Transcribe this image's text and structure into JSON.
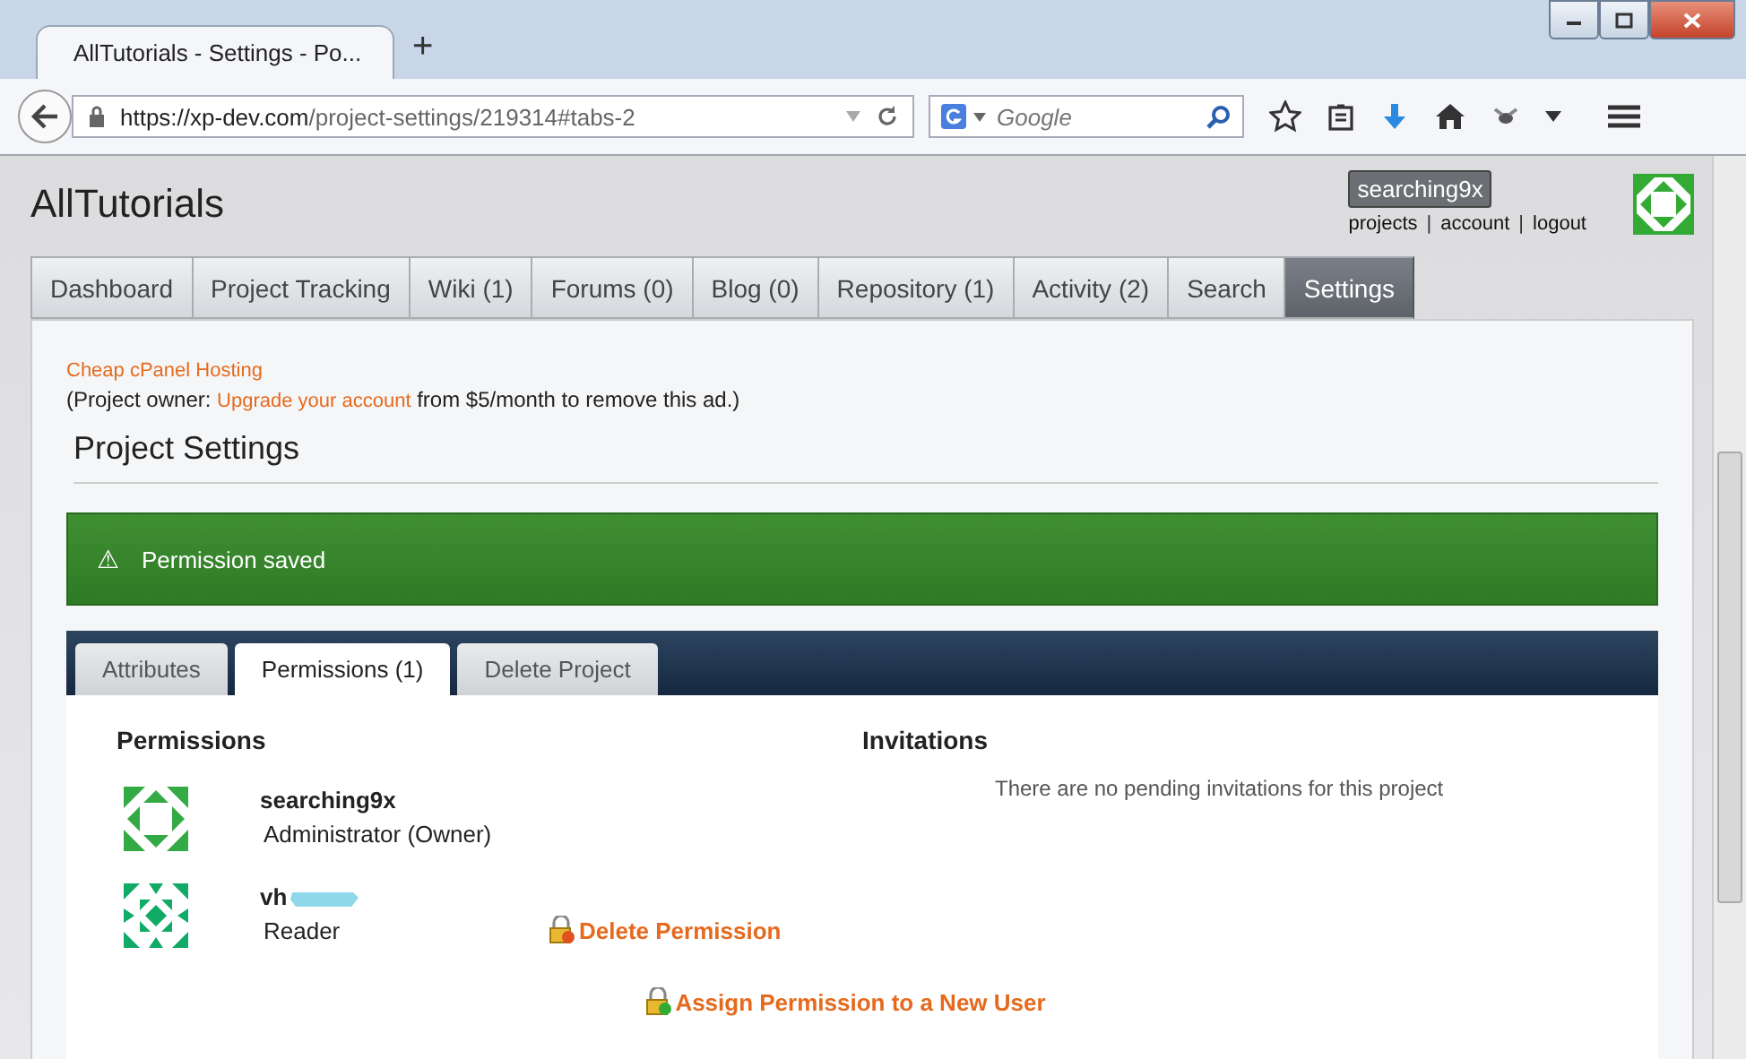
{
  "browser": {
    "tab_title": "AllTutorials - Settings - Po...",
    "new_tab": "+",
    "url_host": "https://xp-dev.com",
    "url_path": "/project-settings/219314#tabs-2",
    "search_placeholder": "Google"
  },
  "site": {
    "title": "AllTutorials",
    "user": "searching9x",
    "user_links": [
      "projects",
      "account",
      "logout"
    ],
    "separator": "|"
  },
  "nav_tabs": [
    {
      "label": "Dashboard",
      "selected": false
    },
    {
      "label": "Project Tracking",
      "selected": false
    },
    {
      "label": "Wiki (1)",
      "selected": false
    },
    {
      "label": "Forums (0)",
      "selected": false
    },
    {
      "label": "Blog (0)",
      "selected": false
    },
    {
      "label": "Repository (1)",
      "selected": false
    },
    {
      "label": "Activity (2)",
      "selected": false
    },
    {
      "label": "Search",
      "selected": false
    },
    {
      "label": "Settings",
      "selected": true
    }
  ],
  "ad": {
    "link": "Cheap cPanel Hosting",
    "before": "(Project owner: ",
    "upgrade_link": "Upgrade your account",
    "after": " from $5/month to remove this ad.)"
  },
  "heading": "Project Settings",
  "alert": {
    "icon": "⚠",
    "message": "Permission saved"
  },
  "settings_tabs": [
    {
      "label": "Attributes",
      "selected": false
    },
    {
      "label": "Permissions (1)",
      "selected": true
    },
    {
      "label": "Delete Project",
      "selected": false
    }
  ],
  "permissions": {
    "title": "Permissions",
    "users": [
      {
        "name": "searching9x",
        "role": "Administrator (Owner)",
        "redacted": false
      },
      {
        "name": "vh",
        "role": "Reader",
        "redacted": true,
        "action": "Delete Permission"
      }
    ],
    "assign": "Assign Permission to a New User"
  },
  "invitations": {
    "title": "Invitations",
    "empty": "There are no pending invitations for this project"
  }
}
